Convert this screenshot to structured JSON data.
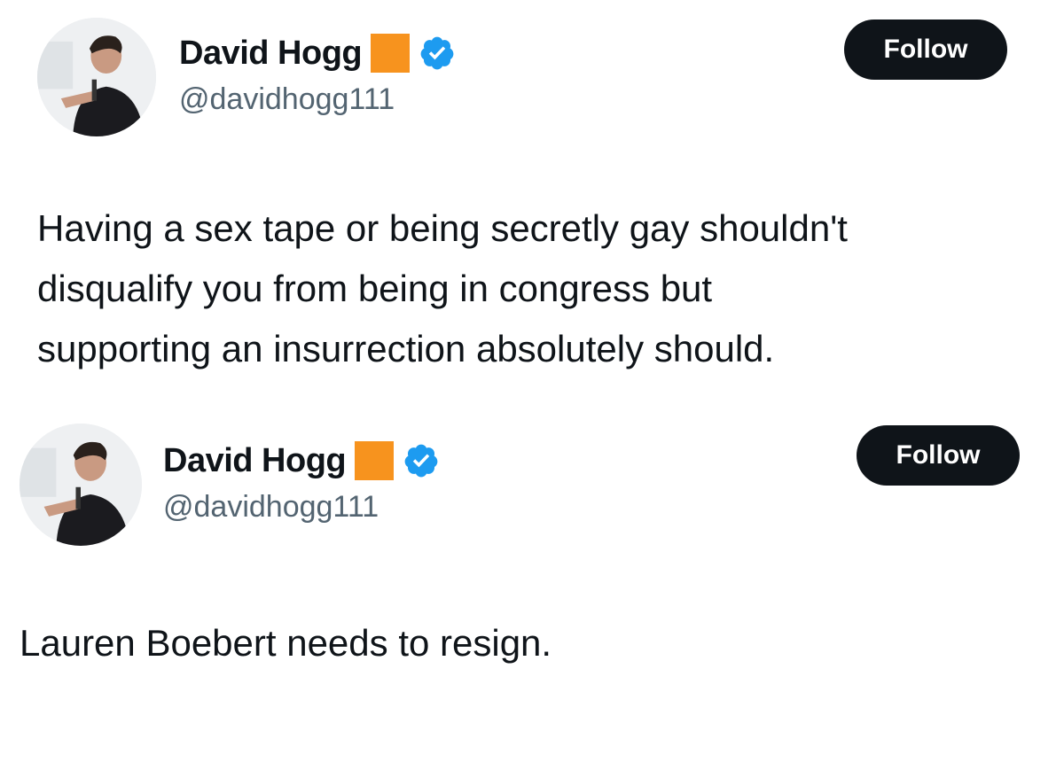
{
  "tweets": [
    {
      "author": {
        "name": "David Hogg",
        "handle": "@davidhogg111",
        "badge_color": "#f7931e",
        "verified_color": "#1d9bf0",
        "avatar": "avatar-photo"
      },
      "follow_label": "Follow",
      "text": "Having a sex tape or being secretly gay shouldn't\ndisqualify you from being in congress but\nsupporting an insurrection absolutely should."
    },
    {
      "author": {
        "name": "David Hogg",
        "handle": "@davidhogg111",
        "badge_color": "#f7931e",
        "verified_color": "#1d9bf0",
        "avatar": "avatar-photo"
      },
      "follow_label": "Follow",
      "text": "Lauren Boebert needs to resign."
    }
  ]
}
